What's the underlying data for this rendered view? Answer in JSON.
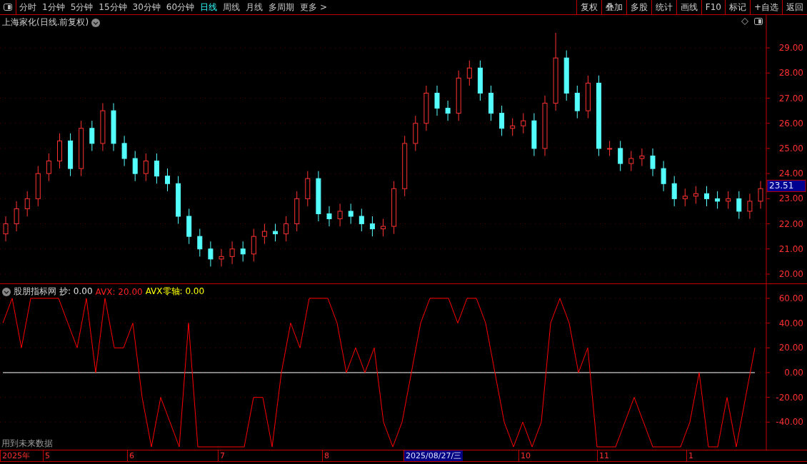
{
  "toolbar": {
    "tabs": [
      {
        "label": "分时",
        "selected": false
      },
      {
        "label": "1分钟",
        "selected": false
      },
      {
        "label": "5分钟",
        "selected": false
      },
      {
        "label": "15分钟",
        "selected": false
      },
      {
        "label": "30分钟",
        "selected": false
      },
      {
        "label": "60分钟",
        "selected": false
      },
      {
        "label": "日线",
        "selected": true
      },
      {
        "label": "周线",
        "selected": false
      },
      {
        "label": "月线",
        "selected": false
      },
      {
        "label": "多周期",
        "selected": false
      },
      {
        "label": "更多 >",
        "selected": false
      }
    ],
    "buttons": [
      "复权",
      "叠加",
      "多股",
      "统计",
      "画线",
      "F10",
      "标记",
      "+自选",
      "返回"
    ]
  },
  "price_chart": {
    "title": "上海家化(日线.前复权)",
    "price_tag": "23.51",
    "chart_data": {
      "type": "candlestick",
      "ylim": [
        19.63,
        30.31
      ],
      "grid": true,
      "yticks": [
        {
          "value": 29,
          "label": "29.00"
        },
        {
          "value": 28,
          "label": "28.00"
        },
        {
          "value": 27,
          "label": "27.00"
        },
        {
          "value": 26,
          "label": "26.00"
        },
        {
          "value": 25,
          "label": "25.00"
        },
        {
          "value": 24,
          "label": "24.00"
        },
        {
          "value": 23,
          "label": "23.00"
        },
        {
          "value": 22,
          "label": "22.00"
        },
        {
          "value": 21,
          "label": "21.00"
        },
        {
          "value": 20,
          "label": "20.00"
        }
      ],
      "ohlc": [
        [
          21.6,
          22.3,
          21.3,
          22.0
        ],
        [
          22.0,
          22.9,
          21.7,
          22.6
        ],
        [
          22.6,
          23.3,
          22.3,
          23.0
        ],
        [
          23.0,
          24.3,
          22.7,
          24.0
        ],
        [
          24.0,
          24.8,
          23.7,
          24.5
        ],
        [
          24.5,
          25.6,
          24.2,
          25.3
        ],
        [
          25.3,
          25.6,
          23.9,
          24.2
        ],
        [
          24.2,
          26.1,
          23.9,
          25.8
        ],
        [
          25.8,
          26.1,
          24.9,
          25.2
        ],
        [
          25.2,
          26.8,
          24.9,
          26.5
        ],
        [
          26.5,
          26.8,
          24.9,
          25.2
        ],
        [
          25.2,
          25.5,
          24.3,
          24.6
        ],
        [
          24.6,
          24.9,
          23.7,
          24.0
        ],
        [
          24.0,
          24.8,
          23.7,
          24.5
        ],
        [
          24.5,
          24.8,
          23.6,
          23.9
        ],
        [
          23.9,
          24.2,
          23.3,
          23.6
        ],
        [
          23.6,
          23.9,
          22.0,
          22.3
        ],
        [
          22.3,
          22.6,
          21.2,
          21.5
        ],
        [
          21.5,
          21.8,
          20.7,
          21.0
        ],
        [
          21.0,
          21.3,
          20.3,
          20.6
        ],
        [
          20.6,
          21.0,
          20.3,
          20.7
        ],
        [
          20.7,
          21.3,
          20.4,
          21.0
        ],
        [
          21.0,
          21.3,
          20.5,
          20.8
        ],
        [
          20.8,
          21.8,
          20.5,
          21.5
        ],
        [
          21.5,
          22.0,
          21.2,
          21.7
        ],
        [
          21.7,
          22.0,
          21.3,
          21.6
        ],
        [
          21.6,
          22.3,
          21.3,
          22.0
        ],
        [
          22.0,
          23.3,
          21.7,
          23.0
        ],
        [
          23.0,
          24.1,
          22.7,
          23.8
        ],
        [
          23.8,
          24.1,
          22.1,
          22.4
        ],
        [
          22.4,
          22.7,
          21.9,
          22.2
        ],
        [
          22.2,
          22.8,
          21.9,
          22.5
        ],
        [
          22.5,
          22.8,
          22.0,
          22.3
        ],
        [
          22.3,
          22.6,
          21.7,
          22.0
        ],
        [
          22.0,
          22.3,
          21.5,
          21.8
        ],
        [
          21.8,
          22.2,
          21.5,
          21.9
        ],
        [
          21.9,
          23.7,
          21.6,
          23.4
        ],
        [
          23.4,
          25.5,
          23.1,
          25.2
        ],
        [
          25.2,
          26.3,
          24.9,
          26.0
        ],
        [
          26.0,
          27.5,
          25.7,
          27.2
        ],
        [
          27.2,
          27.5,
          26.3,
          26.6
        ],
        [
          26.6,
          26.9,
          26.1,
          26.4
        ],
        [
          26.4,
          28.1,
          26.1,
          27.8
        ],
        [
          27.8,
          28.5,
          27.5,
          28.2
        ],
        [
          28.2,
          28.5,
          26.9,
          27.2
        ],
        [
          27.2,
          27.5,
          26.1,
          26.4
        ],
        [
          26.4,
          26.7,
          25.5,
          25.8
        ],
        [
          25.8,
          26.2,
          25.5,
          25.9
        ],
        [
          25.9,
          26.4,
          25.6,
          26.1
        ],
        [
          26.1,
          26.4,
          24.7,
          25.0
        ],
        [
          25.0,
          27.1,
          24.7,
          26.8
        ],
        [
          26.8,
          29.6,
          26.5,
          28.6
        ],
        [
          28.6,
          28.9,
          26.9,
          27.2
        ],
        [
          27.2,
          27.5,
          26.2,
          26.5
        ],
        [
          26.5,
          27.9,
          26.2,
          27.6
        ],
        [
          27.6,
          27.9,
          24.7,
          25.0
        ],
        [
          25.0,
          25.3,
          24.7,
          25.0
        ],
        [
          25.0,
          25.3,
          24.1,
          24.4
        ],
        [
          24.4,
          24.9,
          24.1,
          24.6
        ],
        [
          24.6,
          25.0,
          24.3,
          24.7
        ],
        [
          24.7,
          25.0,
          23.9,
          24.2
        ],
        [
          24.2,
          24.5,
          23.3,
          23.6
        ],
        [
          23.6,
          23.9,
          22.7,
          23.0
        ],
        [
          23.0,
          23.4,
          22.7,
          23.1
        ],
        [
          23.1,
          23.5,
          22.8,
          23.2
        ],
        [
          23.2,
          23.5,
          22.7,
          23.0
        ],
        [
          23.0,
          23.3,
          22.6,
          22.9
        ],
        [
          22.9,
          23.3,
          22.6,
          23.0
        ],
        [
          23.0,
          23.3,
          22.2,
          22.5
        ],
        [
          22.5,
          23.2,
          22.2,
          22.9
        ],
        [
          22.9,
          23.7,
          22.6,
          23.4
        ]
      ]
    }
  },
  "indicator": {
    "name": "股朋指标网",
    "legend": [
      {
        "label": "抄: 0.00",
        "color": "#e0e0e0"
      },
      {
        "label": "AVX: 20.00",
        "color": "#ff2020"
      },
      {
        "label": "AVX零轴: 0.00",
        "color": "#ffff00"
      }
    ],
    "note": "用到未来数据",
    "chart_data": {
      "type": "line",
      "ylim": [
        -62.3,
        71.5
      ],
      "grid": true,
      "yticks": [
        {
          "value": 60,
          "label": "60.00"
        },
        {
          "value": 40,
          "label": "40.00"
        },
        {
          "value": 20,
          "label": "20.00"
        },
        {
          "value": 0,
          "label": "0.00"
        },
        {
          "value": -20,
          "label": "-20.00"
        },
        {
          "value": -40,
          "label": "-40.00"
        }
      ],
      "series": [
        {
          "color": "#ff0000",
          "values": [
            40,
            60,
            20,
            60,
            60,
            60,
            60,
            40,
            20,
            60,
            0,
            60,
            20,
            20,
            40,
            -20,
            -60,
            -20,
            -40,
            -60,
            40,
            -60,
            -60,
            -60,
            -60,
            -60,
            -60,
            -20,
            -20,
            -60,
            0,
            40,
            20,
            60,
            60,
            60,
            40,
            0,
            20,
            0,
            20,
            -40,
            -60,
            -40,
            0,
            40,
            60,
            60,
            60,
            40,
            60,
            60,
            40,
            0,
            -40,
            -60,
            -40,
            -60,
            -40,
            40,
            60,
            40,
            0,
            20,
            -60,
            -60,
            -60,
            -40,
            -20,
            -40,
            -60,
            -60,
            -60,
            -60,
            -40,
            0,
            -60,
            -60,
            -20,
            -60,
            -20,
            20
          ]
        }
      ]
    }
  },
  "time_axis": [
    {
      "label": "2025年",
      "selected": false
    },
    {
      "label": "5",
      "selected": false
    },
    {
      "label": "6",
      "selected": false
    },
    {
      "label": "7",
      "selected": false
    },
    {
      "label": "8",
      "selected": false
    },
    {
      "label": "2025/08/27/三",
      "selected": true
    },
    {
      "label": "10",
      "selected": false
    },
    {
      "label": "11",
      "selected": false
    },
    {
      "label": "1",
      "selected": false
    }
  ]
}
